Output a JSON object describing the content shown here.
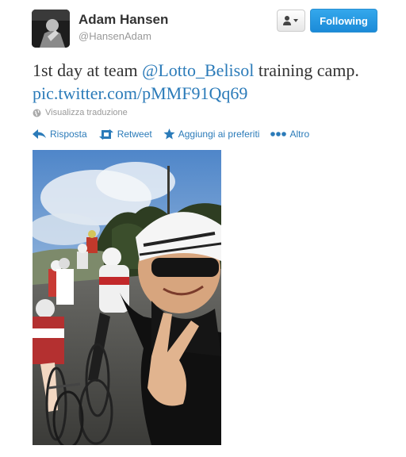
{
  "user": {
    "name": "Adam Hansen",
    "handle": "@HansenAdam"
  },
  "buttons": {
    "follow_label": "Following",
    "user_menu_icon": "person-dropdown-icon"
  },
  "tweet": {
    "text_start": "1st day at team ",
    "mention": "@Lotto_Belisol",
    "text_mid": " training camp. ",
    "link": "pic.twitter.com/pMMF91Qq69"
  },
  "translate": {
    "icon": "globe-icon",
    "label": "Visualizza traduzione"
  },
  "actions": {
    "reply": "Risposta",
    "retweet": "Retweet",
    "favorite": "Aggiungi ai preferiti",
    "more": "Altro"
  },
  "colors": {
    "link": "#2b7bb9",
    "follow_button": "#1b8ad8",
    "muted_text": "#999999"
  }
}
